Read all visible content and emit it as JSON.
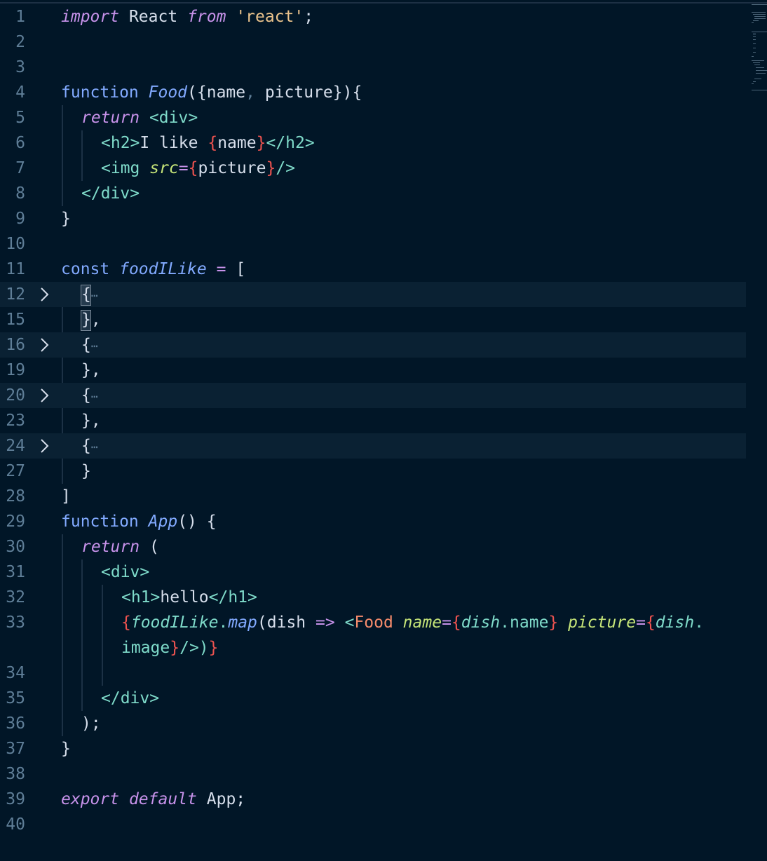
{
  "editor": {
    "line_numbers": [
      "1",
      "2",
      "3",
      "4",
      "5",
      "6",
      "7",
      "8",
      "9",
      "10",
      "11",
      "12",
      "15",
      "16",
      "19",
      "20",
      "23",
      "24",
      "27",
      "28",
      "29",
      "30",
      "31",
      "32",
      "33",
      "34",
      "35",
      "36",
      "37",
      "38",
      "39",
      "40"
    ],
    "fold_icon": "chevron-right-icon",
    "colors": {
      "background": "#011627",
      "keyword": "#c792ea",
      "function": "#82aaff",
      "string": "#ecc48d",
      "tag": "#7fdbca",
      "brace": "#ef5350",
      "attribute": "#c5e478",
      "component": "#f78c6c"
    }
  },
  "code": {
    "l1": {
      "import": "import",
      "react": "React",
      "from": "from",
      "str": "'react'",
      "semi": ";"
    },
    "l4": {
      "fn": "function",
      "name": "Food",
      "params": "({name",
      "comma": ",",
      "params2": " picture}){"
    },
    "l5": {
      "ret": "return",
      "div": "<div>"
    },
    "l6": {
      "open": "<h2>",
      "text": "I like ",
      "lb": "{",
      "var": "name",
      "rb": "}",
      "close": "</h2>"
    },
    "l7": {
      "open": "<img",
      "attr": "src",
      "eq": "=",
      "lb": "{",
      "var": "picture",
      "rb": "}",
      "close": "/>"
    },
    "l8": {
      "close": "</div>"
    },
    "l9": {
      "text": "}"
    },
    "l11": {
      "kw": "const",
      "name": "foodILike",
      "eq": "=",
      "br": "["
    },
    "fold_open": "{",
    "fold_ellipsis": "⋯",
    "l15": {
      "text": "},"
    },
    "l19": {
      "text": "},"
    },
    "l23": {
      "text": "},"
    },
    "l27": {
      "text": "}"
    },
    "l28": {
      "text": "]"
    },
    "l29": {
      "fn": "function",
      "name": "App",
      "rest": "() {"
    },
    "l30": {
      "ret": "return",
      "paren": "("
    },
    "l31": {
      "div": "<div>"
    },
    "l32": {
      "open": "<h1>",
      "text": "hello",
      "close": "</h1>"
    },
    "l33": {
      "lb": "{",
      "arr": "foodILike",
      "dot": ".",
      "map": "map",
      "paren": "(",
      "arg": "dish",
      "arrow": "=>",
      "lt": "<",
      "comp": "Food",
      "a1": "name",
      "eq1": "=",
      "lb1": "{",
      "v1": "dish",
      "d1": ".",
      "p1": "name",
      "rb1": "}",
      "a2": "picture",
      "eq2": "=",
      "lb2": "{",
      "v2": "dish",
      "d2": "."
    },
    "l33b": {
      "p2": "image",
      "rb2": "}",
      "close": "/>)",
      "rb": "}"
    },
    "l35": {
      "close": "</div>"
    },
    "l36": {
      "text": ");"
    },
    "l37": {
      "text": "}"
    },
    "l39": {
      "exp": "export",
      "def": "default",
      "app": "App",
      "semi": ";"
    }
  }
}
